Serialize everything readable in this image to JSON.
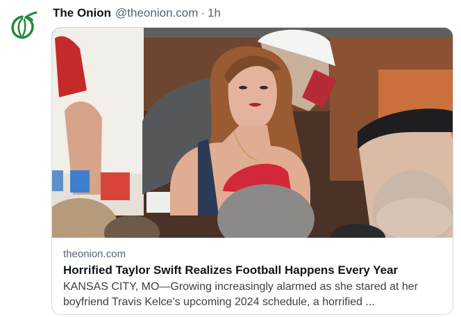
{
  "post": {
    "author_name": "The Onion",
    "author_handle": "@theonion.com",
    "separator": "·",
    "time": "1h",
    "avatar_icon": "onion-logo-icon",
    "brand_color": "#1f8a3a"
  },
  "card": {
    "image_alt": "Taylor Swift in stadium suite",
    "domain": "theonion.com",
    "title": "Horrified Taylor Swift Realizes Football Happens Every Year",
    "description": "KANSAS CITY, MO—Growing increasingly alarmed as she stared at her boyfriend Travis Kelce’s upcoming 2024 schedule, a horrified ..."
  }
}
